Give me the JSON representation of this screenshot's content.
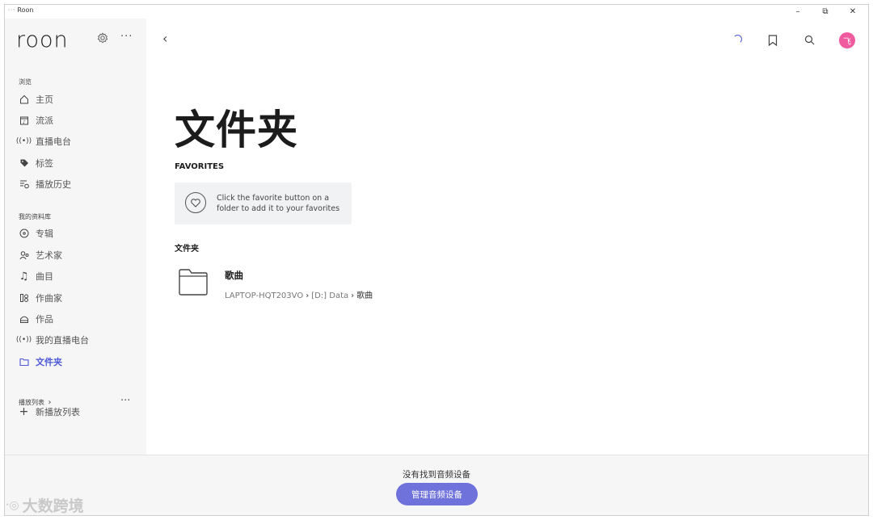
{
  "window": {
    "title": "Roon",
    "controls": {
      "minimize": "–",
      "maximize": "⧉",
      "close": "✕"
    }
  },
  "sidebar": {
    "logo": "roon",
    "browse_label": "浏览",
    "browse_items": [
      {
        "label": "主页",
        "icon": "home-icon"
      },
      {
        "label": "流派",
        "icon": "genre-icon"
      },
      {
        "label": "直播电台",
        "icon": "radio-icon"
      },
      {
        "label": "标签",
        "icon": "tag-icon"
      },
      {
        "label": "播放历史",
        "icon": "history-icon"
      }
    ],
    "library_label": "我的资料库",
    "library_items": [
      {
        "label": "专辑",
        "icon": "album-icon"
      },
      {
        "label": "艺术家",
        "icon": "artist-icon"
      },
      {
        "label": "曲目",
        "icon": "track-icon"
      },
      {
        "label": "作曲家",
        "icon": "composer-icon"
      },
      {
        "label": "作品",
        "icon": "composition-icon"
      },
      {
        "label": "我的直播电台",
        "icon": "my-radio-icon"
      },
      {
        "label": "文件夹",
        "icon": "folder-icon",
        "active": true
      }
    ],
    "playlists_label": "播放列表",
    "new_playlist": "新播放列表"
  },
  "header": {
    "avatar_text": "飞"
  },
  "main": {
    "title": "文件夹",
    "favorites_heading": "FAVORITES",
    "favorites_hint": "Click the favorite button on a folder to add it to your favorites",
    "folders_heading": "文件夹",
    "folders": [
      {
        "name": "歌曲",
        "path": [
          "LAPTOP-HQT203VO",
          "[D:] Data",
          "歌曲"
        ]
      }
    ]
  },
  "footer": {
    "message": "没有找到音频设备",
    "button": "管理音频设备"
  },
  "watermark": "大数跨境",
  "colors": {
    "accent": "#4c57d6",
    "button": "#6f72db",
    "avatar": "#f05a9f"
  }
}
